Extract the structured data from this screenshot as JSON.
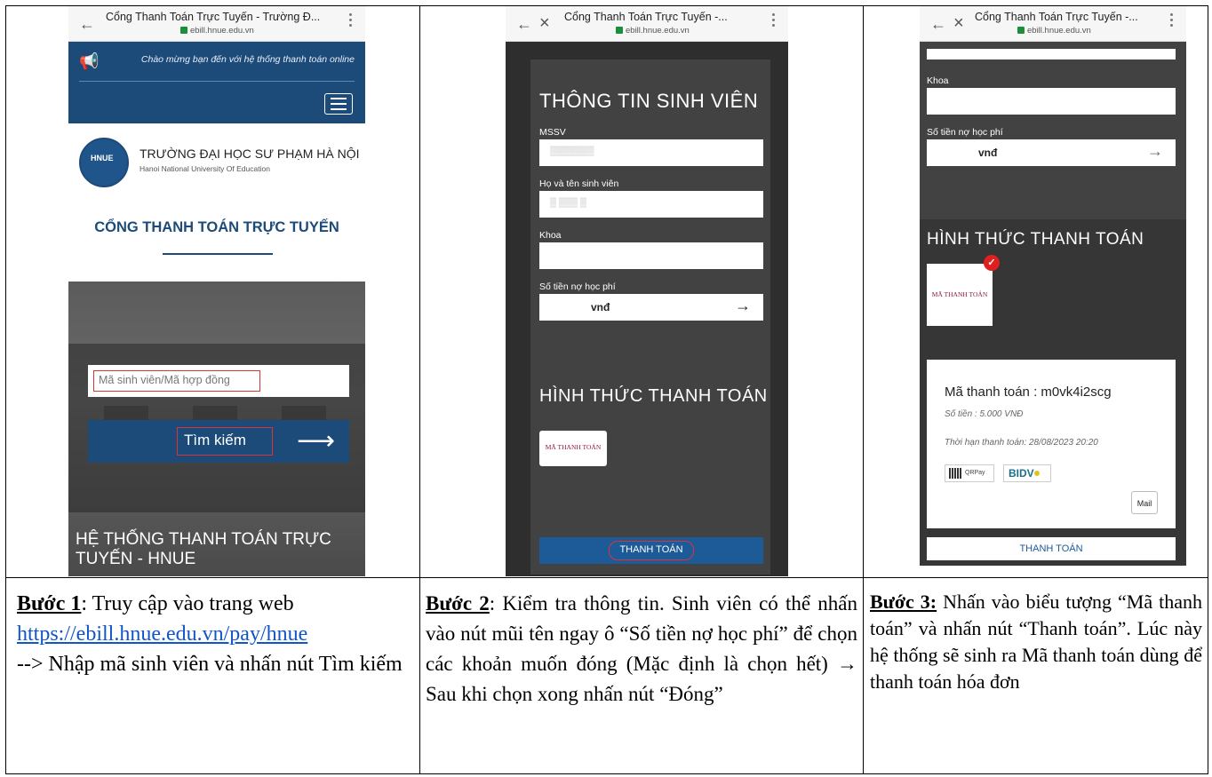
{
  "phone1": {
    "browser": {
      "title": "Cổng Thanh Toán Trực Tuyến - Trường Đ...",
      "url": "ebill.hnue.edu.vn"
    },
    "welcome": "Chào mừng bạn đến với hệ thống thanh toán online",
    "school_name": "TRƯỜNG ĐẠI HỌC SƯ PHẠM HÀ NỘI",
    "school_name_en": "Hanoi National University Of Education",
    "logo_text": "HNUE",
    "portal_title": "CỔNG THANH TOÁN TRỰC TUYẾN",
    "search_placeholder": "Mã sinh viên/Mã hợp đồng",
    "search_button": "Tìm kiếm",
    "bottom_title": "HỆ THỐNG THANH TOÁN TRỰC TUYẾN - HNUE"
  },
  "phone2": {
    "browser": {
      "title": "Cổng Thanh Toán Trực Tuyến -...",
      "url": "ebill.hnue.edu.vn"
    },
    "section_info": "THÔNG TIN SINH VIÊN",
    "label_mssv": "MSSV",
    "label_name": "Họ và tên sinh viên",
    "label_faculty": "Khoa",
    "label_debt": "Số tiền nợ học phí",
    "currency": "vnđ",
    "section_method": "HÌNH THỨC THANH TOÁN",
    "pay_code_option": "MÃ THANH TOÁN",
    "pay_button": "THANH TOÁN"
  },
  "phone3": {
    "browser": {
      "title": "Cổng Thanh Toán Trực Tuyến -...",
      "url": "ebill.hnue.edu.vn"
    },
    "label_faculty": "Khoa",
    "label_debt": "Số tiền nợ học phí",
    "currency": "vnđ",
    "section_method": "HÌNH THỨC THANH TOÁN",
    "pay_code_option": "MÃ THANH TOÁN",
    "payment_code": "Mã thanh toán : m0vk4i2scg",
    "amount": "Số tiền : 5.000 VNĐ",
    "deadline": "Thời hạn thanh toán: 28/08/2023 20:20",
    "qr_label": "QRPay",
    "bank_label": "BIDV",
    "mail_button": "Mail",
    "pay_button": "THANH TOÁN"
  },
  "captions": {
    "step1_label": "Bước 1",
    "step1_text_a": ": Truy cập vào trang web",
    "step1_link": "https://ebill.hnue.edu.vn/pay/hnue",
    "step1_text_b": "--> Nhập mã sinh viên và nhấn nút Tìm kiếm",
    "step2_label": "Bước 2",
    "step2_text": ": Kiểm tra thông tin. Sinh viên có thể nhấn vào nút mũi tên ngay ô “Số tiền nợ học phí” để chọn các khoản muốn đóng (Mặc định là chọn hết) → Sau khi chọn xong nhấn nút “Đóng”",
    "step3_label": "Bước 3:",
    "step3_text": " Nhấn vào biểu tượng “Mã thanh toán” và nhấn nút “Thanh toán”. Lúc này hệ thống sẽ sinh ra Mã thanh toán dùng để thanh toán hóa đơn"
  },
  "colors": {
    "brand_blue": "#1d4b79",
    "highlight_red": "#d33333",
    "link_blue": "#1155cc"
  }
}
